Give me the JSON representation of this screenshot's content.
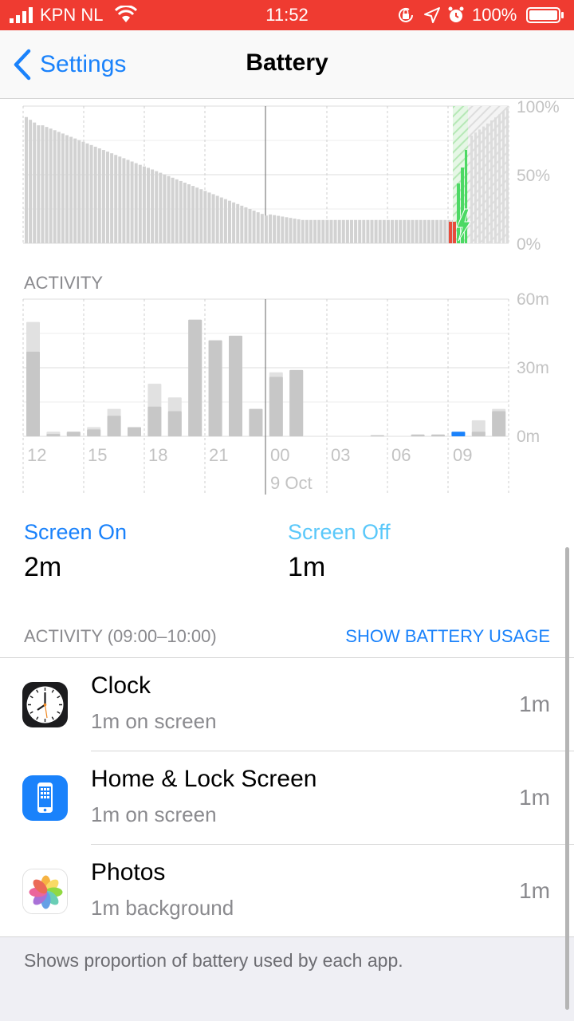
{
  "status_bar": {
    "carrier": "KPN NL",
    "time": "11:52",
    "battery_pct": "100%"
  },
  "nav": {
    "back_label": "Settings",
    "title": "Battery"
  },
  "battery_chart": {
    "y_labels": [
      "100%",
      "50%",
      "0%"
    ]
  },
  "activity_chart": {
    "header": "ACTIVITY",
    "y_labels": [
      "60m",
      "30m",
      "0m"
    ],
    "x_labels": [
      "12",
      "15",
      "18",
      "21",
      "00",
      "03",
      "06",
      "09"
    ],
    "date_label": "9 Oct"
  },
  "stats": {
    "screen_on": {
      "label": "Screen On",
      "value": "2m"
    },
    "screen_off": {
      "label": "Screen Off",
      "value": "1m"
    }
  },
  "section": {
    "header": "ACTIVITY (09:00–10:00)",
    "link": "SHOW BATTERY USAGE"
  },
  "apps": [
    {
      "name": "Clock",
      "detail": "1m on screen",
      "time": "1m",
      "icon": "clock-icon"
    },
    {
      "name": "Home & Lock Screen",
      "detail": "1m on screen",
      "time": "1m",
      "icon": "phone-icon"
    },
    {
      "name": "Photos",
      "detail": "1m background",
      "time": "1m",
      "icon": "photos-icon"
    }
  ],
  "footer": {
    "text": "Shows proportion of battery used by each app."
  },
  "colors": {
    "status_bar": "#ef3b31",
    "accent": "#1a82fb",
    "screen_off": "#5ac8fa",
    "charge": "#4cd964"
  }
}
